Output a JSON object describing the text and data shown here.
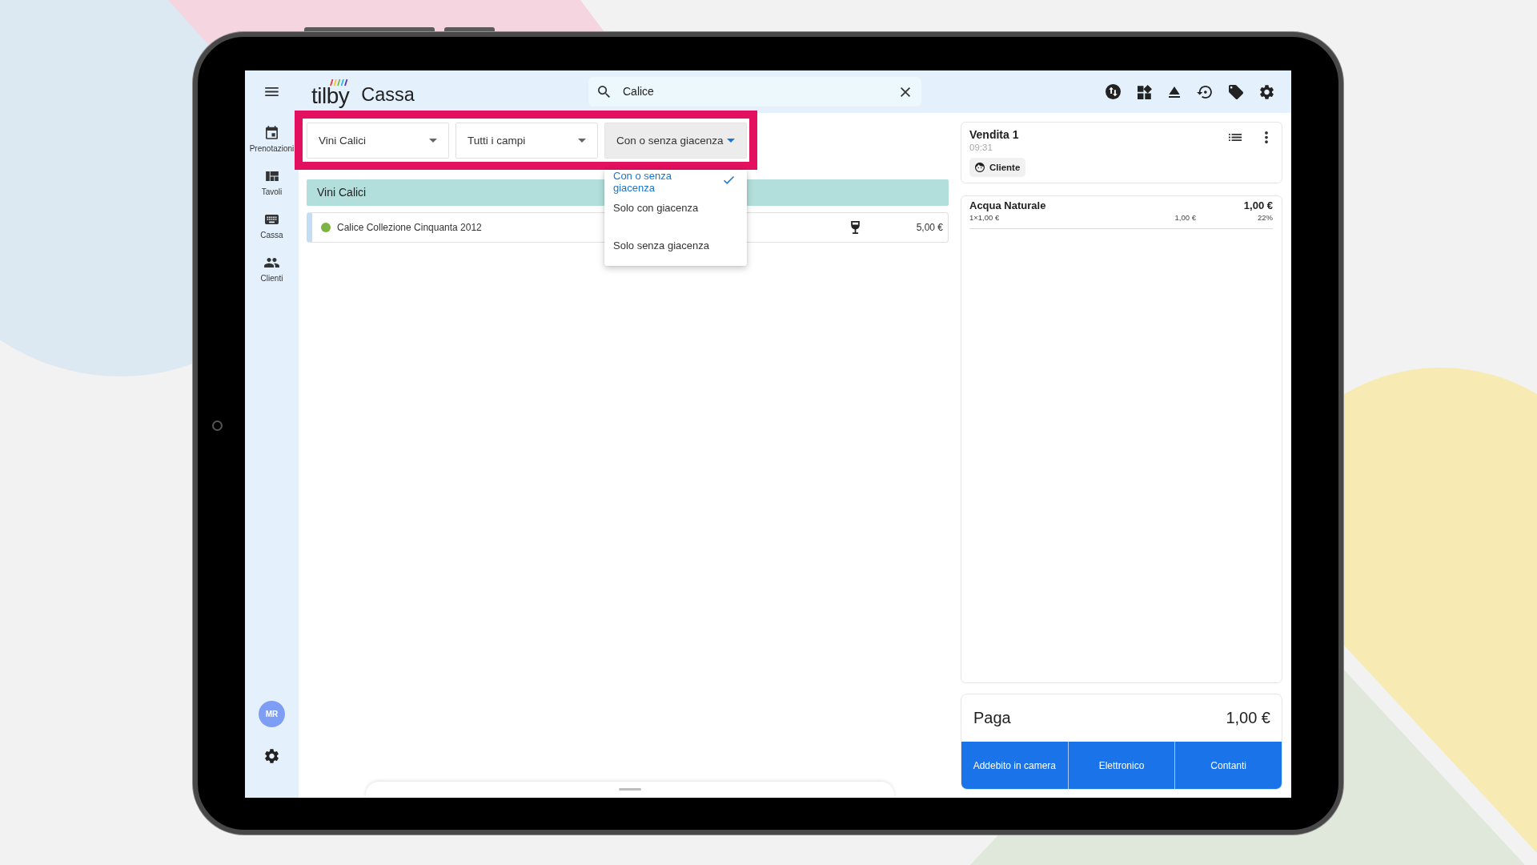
{
  "topbar": {
    "logo": "tilby",
    "title": "Cassa",
    "search": {
      "value": "Calice"
    }
  },
  "sidebar": {
    "items": [
      "Prenotazioni",
      "Tavoli",
      "Cassa",
      "Clienti"
    ],
    "avatar": "MR"
  },
  "filter_bar": {
    "highlighted": true,
    "filters": [
      {
        "value": "Vini Calici",
        "open": false
      },
      {
        "value": "Tutti i campi",
        "open": false
      },
      {
        "value": "Con o senza giacenza",
        "open": true,
        "options": [
          {
            "label": "Con o senza giacenza",
            "selected": true
          },
          {
            "label": "Solo con giacenza",
            "selected": false
          },
          {
            "label": "Solo senza giacenza",
            "selected": false
          }
        ]
      }
    ]
  },
  "catalog": {
    "categories": [
      {
        "name": "Vini Calici",
        "products": [
          {
            "name": "Calice Collezione Cinquanta 2012",
            "price": "5,00 €",
            "color": "#7cb342"
          }
        ]
      }
    ]
  },
  "sale": {
    "title": "Vendita 1",
    "time": "09:31",
    "customer": "Cliente",
    "items": [
      {
        "name": "Acqua Naturale",
        "total": "1,00 €",
        "quantity": "1×1,00 €",
        "unit_price": "1,00 €",
        "vat": "22%"
      }
    ]
  },
  "payment": {
    "label": "Paga",
    "amount": "1,00 €",
    "methods": [
      "Addebito in camera",
      "Elettronico",
      "Contanti"
    ]
  }
}
